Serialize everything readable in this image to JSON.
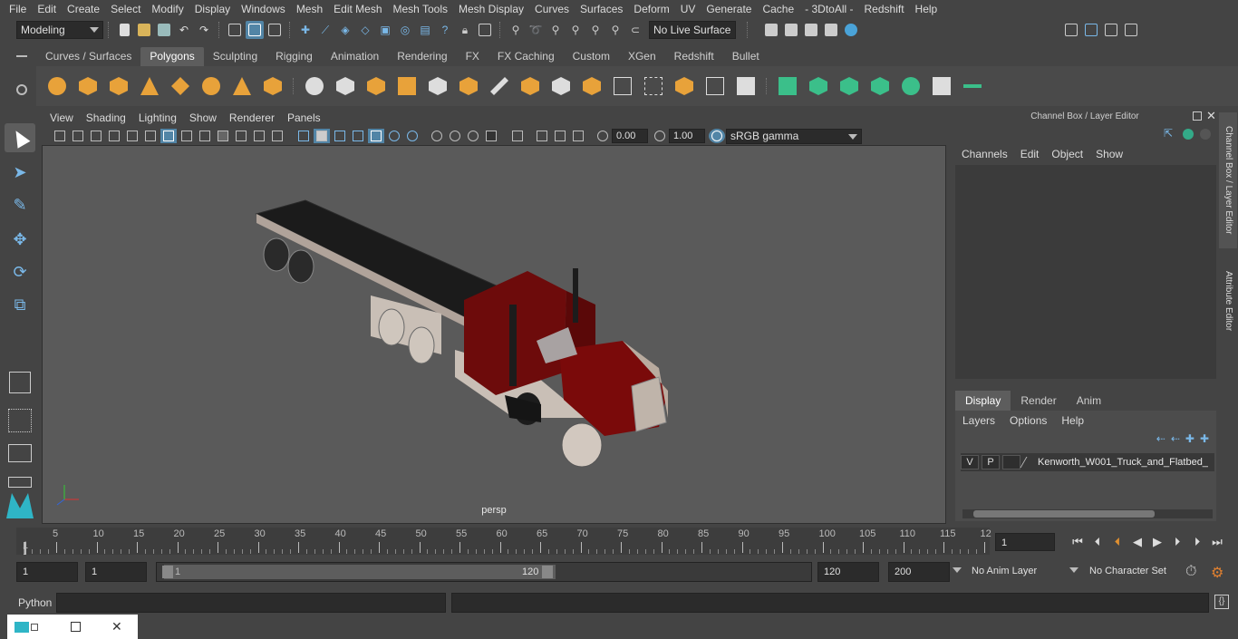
{
  "menubar": [
    "File",
    "Edit",
    "Create",
    "Select",
    "Modify",
    "Display",
    "Windows",
    "Mesh",
    "Edit Mesh",
    "Mesh Tools",
    "Mesh Display",
    "Curves",
    "Surfaces",
    "Deform",
    "UV",
    "Generate",
    "Cache",
    "- 3DtoAll -",
    "Redshift",
    "Help"
  ],
  "status": {
    "mode": "Modeling",
    "live_surface": "No Live Surface"
  },
  "shelf": {
    "tabs": [
      "Curves / Surfaces",
      "Polygons",
      "Sculpting",
      "Rigging",
      "Animation",
      "Rendering",
      "FX",
      "FX Caching",
      "Custom",
      "XGen",
      "Redshift",
      "Bullet"
    ],
    "active": "Polygons"
  },
  "viewport": {
    "menu": [
      "View",
      "Shading",
      "Lighting",
      "Show",
      "Renderer",
      "Panels"
    ],
    "exposure": "0.00",
    "gamma": "1.00",
    "color_space": "sRGB gamma",
    "camera_label": "persp"
  },
  "channel_box": {
    "title": "Channel Box / Layer Editor",
    "menu": [
      "Channels",
      "Edit",
      "Object",
      "Show"
    ],
    "side_tab_1": "Channel Box / Layer Editor",
    "side_tab_2": "Attribute Editor"
  },
  "layers": {
    "tabs": [
      "Display",
      "Render",
      "Anim"
    ],
    "active": "Display",
    "menu": [
      "Layers",
      "Options",
      "Help"
    ],
    "row": {
      "v": "V",
      "p": "P",
      "name": "Kenworth_W001_Truck_and_Flatbed_"
    }
  },
  "timeline": {
    "labels": [
      "5",
      "10",
      "15",
      "20",
      "25",
      "30",
      "35",
      "40",
      "45",
      "50",
      "55",
      "60",
      "65",
      "70",
      "75",
      "80",
      "85",
      "90",
      "95",
      "100",
      "105",
      "110",
      "115",
      "12"
    ],
    "start_marker": "1",
    "current_frame": "1"
  },
  "range": {
    "start": "1",
    "playback_start": "1",
    "slider_start": "1",
    "slider_end": "120",
    "end": "120",
    "anim_end": "200",
    "anim_layer": "No Anim Layer",
    "character_set": "No Character Set"
  },
  "command": {
    "label": "Python"
  },
  "colors": {
    "accent": "#5285a6",
    "bg": "#444444",
    "truck_red": "#7a0a0a"
  }
}
